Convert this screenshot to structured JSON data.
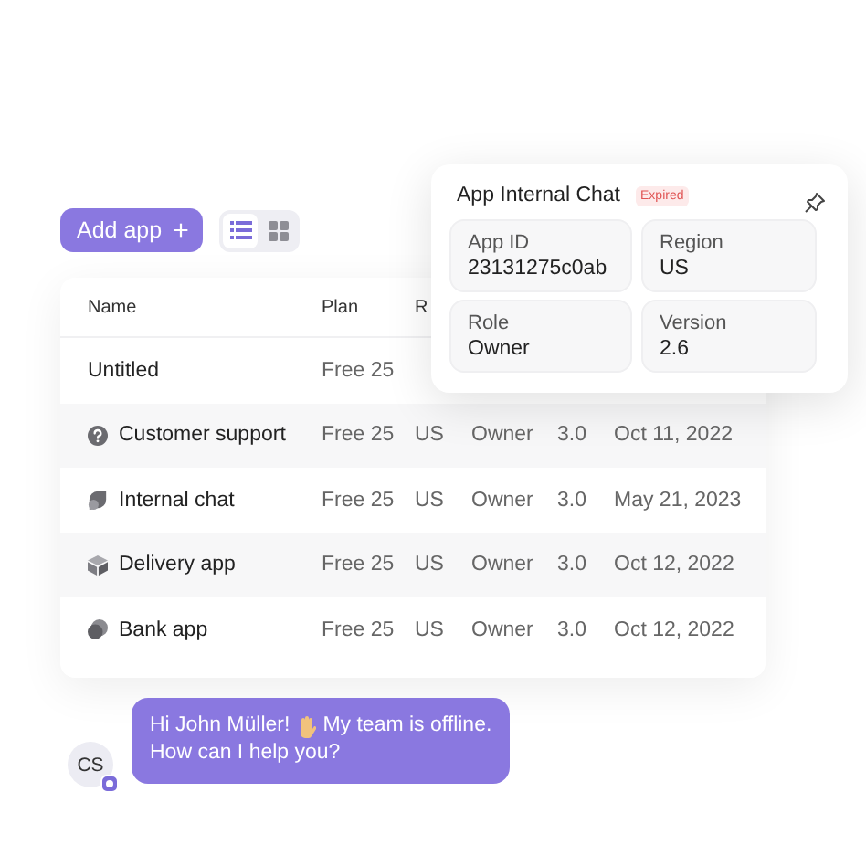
{
  "toolbar": {
    "add_button": "Add app",
    "add_icon": "+",
    "view_toggle": [
      {
        "kind": "list",
        "selected": true
      },
      {
        "kind": "grid",
        "selected": false
      }
    ]
  },
  "table": {
    "columns": [
      "Name",
      "Plan",
      "R"
    ],
    "rows": [
      {
        "cells": [
          "Untitled",
          "Free 25"
        ]
      },
      {
        "cells": [
          "Customer support",
          "Free 25",
          "US",
          "Owner",
          "3.0",
          "Oct 11, 2022"
        ]
      },
      {
        "cells": [
          "Internal chat",
          "Free 25",
          "US",
          "Owner",
          "3.0",
          "May 21, 2023"
        ]
      },
      {
        "cells": [
          "Delivery app",
          "Free 25",
          "US",
          "Owner",
          "3.0",
          "Oct 12, 2022"
        ]
      },
      {
        "cells": [
          "Bank app",
          "Free 25",
          "US",
          "Owner",
          "3.0",
          "Oct 12, 2022"
        ]
      }
    ]
  },
  "popup": {
    "title": "App Internal Chat",
    "badge": "Expired",
    "fields": [
      {
        "label": "App ID",
        "value": "23131275c0ab"
      },
      {
        "label": "Region",
        "value": "US"
      },
      {
        "label": "Role",
        "value": "Owner"
      },
      {
        "label": "Version",
        "value": "2.6"
      }
    ]
  },
  "chat": {
    "avatar": "CS",
    "message_start": "Hi John Müller!",
    "message_middle": "My team is offline.",
    "message_end": "How can I help you?"
  }
}
